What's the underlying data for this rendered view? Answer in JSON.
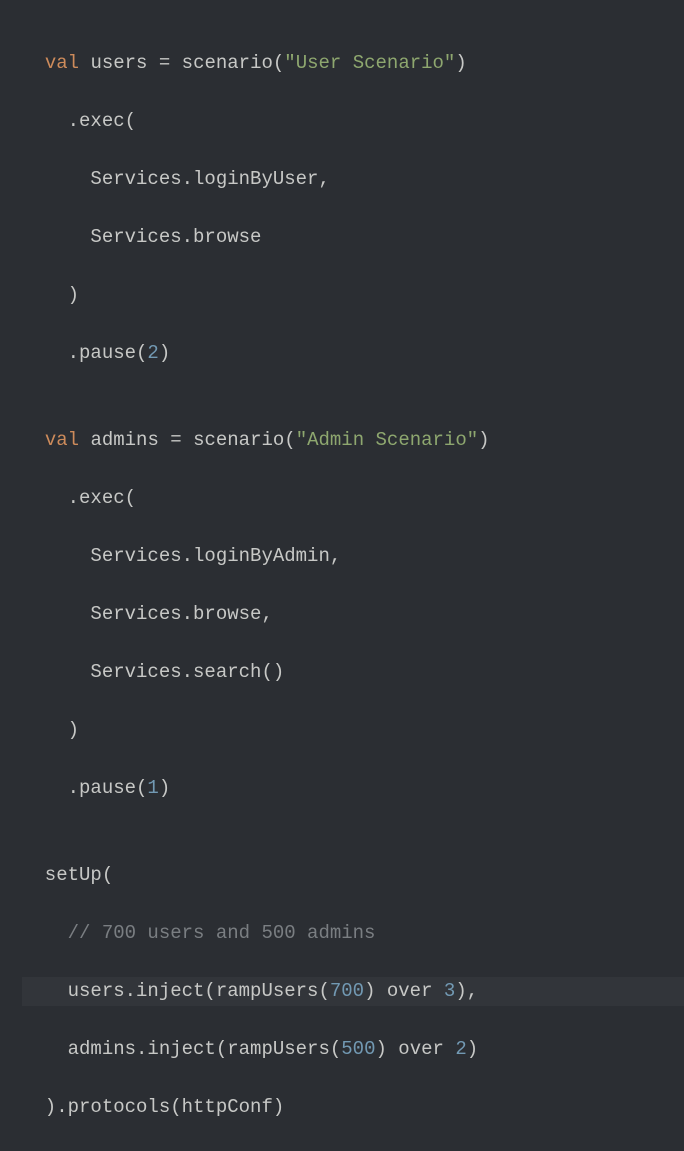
{
  "code": {
    "line1": {
      "kw": "val",
      "name": "users",
      "eq": " = ",
      "fn": "scenario",
      "open": "(",
      "str": "\"User Scenario\"",
      "close": ")"
    },
    "line2": {
      "text": "    .exec("
    },
    "line3": {
      "text": "      Services.loginByUser,"
    },
    "line4": {
      "text": "      Services.browse"
    },
    "line5": {
      "text": "    )"
    },
    "line6": {
      "prefix": "    .pause(",
      "num": "2",
      "suffix": ")"
    },
    "line7": {
      "text": ""
    },
    "line8": {
      "kw": "val",
      "name": "admins",
      "eq": " = ",
      "fn": "scenario",
      "open": "(",
      "str": "\"Admin Scenario\"",
      "close": ")"
    },
    "line9": {
      "text": "    .exec("
    },
    "line10": {
      "text": "      Services.loginByAdmin,"
    },
    "line11": {
      "text": "      Services.browse,"
    },
    "line12": {
      "text": "      Services.search()"
    },
    "line13": {
      "text": "    )"
    },
    "line14": {
      "prefix": "    .pause(",
      "num": "1",
      "suffix": ")"
    },
    "line15": {
      "text": ""
    },
    "line16": {
      "text": "  setUp("
    },
    "line17": {
      "prefix": "    ",
      "comment": "// 700 users and 500 admins"
    },
    "line18": {
      "p1": "    users.inject(rampUsers(",
      "n1": "700",
      "p2": ") over ",
      "n2": "3",
      "p3": "),"
    },
    "line19": {
      "p1": "    admins.inject(rampUsers(",
      "n1": "500",
      "p2": ") over ",
      "n2": "2",
      "p3": ")"
    },
    "line20": {
      "text": "  ).protocols(httpConf)"
    }
  }
}
